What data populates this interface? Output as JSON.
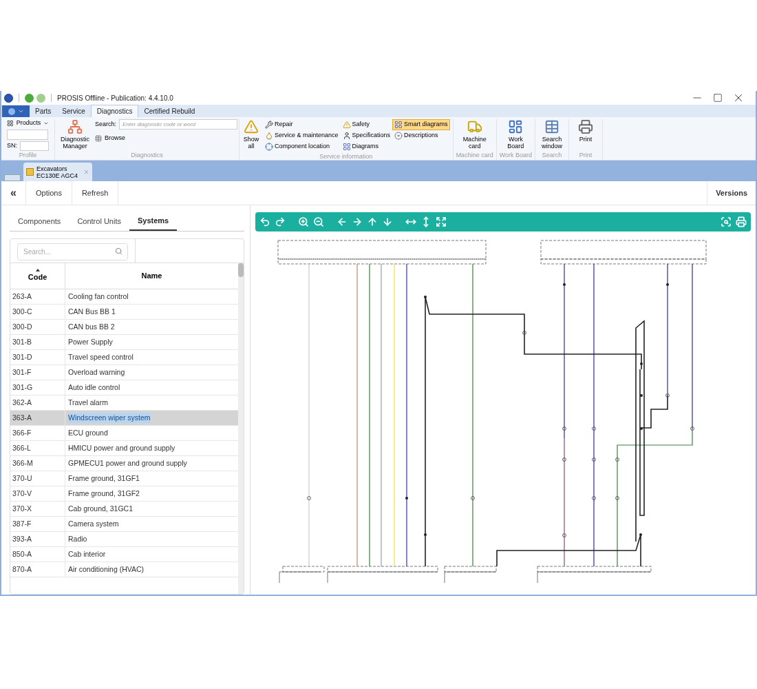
{
  "window": {
    "title": "PROSIS Offline - Publication: 4.4.10.0"
  },
  "ribbon": {
    "tabs": [
      {
        "label": "Parts",
        "selected": false
      },
      {
        "label": "Service",
        "selected": false
      },
      {
        "label": "Diagnostics",
        "selected": true
      },
      {
        "label": "Certified Rebuild",
        "selected": false
      }
    ],
    "profile": {
      "products": "Products",
      "sn_label": "SN:",
      "group": "Profile"
    },
    "diagnostics": {
      "manager": "Diagnostic Manager",
      "search_label": "Search:",
      "search_placeholder": "Enter diagnostic code or word",
      "browse": "Browse",
      "group": "Diagnostics"
    },
    "service_information": {
      "show_all": "Show all",
      "items": [
        {
          "label": "Repair",
          "kind": "wrench",
          "selected": false
        },
        {
          "label": "Service & maintenance",
          "kind": "oil",
          "selected": false
        },
        {
          "label": "Component location",
          "kind": "location",
          "selected": false
        },
        {
          "label": "Safety",
          "kind": "warning",
          "selected": false
        },
        {
          "label": "Specifications",
          "kind": "spec",
          "selected": false
        },
        {
          "label": "Diagrams",
          "kind": "grid",
          "selected": false
        },
        {
          "label": "Smart diagrams",
          "kind": "grid",
          "selected": true
        },
        {
          "label": "Descriptions",
          "kind": "disk",
          "selected": false
        }
      ],
      "group": "Service information"
    },
    "big_groups": [
      {
        "button": "Machine card",
        "kind": "machine",
        "group": "Machine card"
      },
      {
        "button": "Work Board",
        "kind": "board",
        "group": "Work Board"
      },
      {
        "button": "Search window",
        "kind": "search",
        "group": "Search"
      },
      {
        "button": "Print",
        "kind": "print",
        "group": "Print"
      }
    ]
  },
  "document_tab": {
    "line1": "Excavators",
    "line2": "EC130E AGC4"
  },
  "toolbar": {
    "collapse": "«",
    "buttons": [
      "Options",
      "Refresh"
    ],
    "versions": "Versions"
  },
  "panel_tabs": [
    {
      "label": "Components",
      "selected": false
    },
    {
      "label": "Control Units",
      "selected": false
    },
    {
      "label": "Systems",
      "selected": true
    }
  ],
  "search": {
    "placeholder": "Search..."
  },
  "table": {
    "columns": [
      "Code",
      "Name"
    ],
    "rows": [
      {
        "code": "263-A",
        "name": "Cooling fan control",
        "selected": false
      },
      {
        "code": "300-C",
        "name": "CAN Bus BB 1",
        "selected": false
      },
      {
        "code": "300-D",
        "name": "CAN bus BB 2",
        "selected": false
      },
      {
        "code": "301-B",
        "name": "Power Supply",
        "selected": false
      },
      {
        "code": "301-D",
        "name": "Travel speed control",
        "selected": false
      },
      {
        "code": "301-F",
        "name": "Overload warning",
        "selected": false
      },
      {
        "code": "301-G",
        "name": "Auto idle control",
        "selected": false
      },
      {
        "code": "362-A",
        "name": "Travel alarm",
        "selected": false
      },
      {
        "code": "363-A",
        "name": "Windscreen wiper system",
        "selected": true
      },
      {
        "code": "366-F",
        "name": "ECU ground",
        "selected": false
      },
      {
        "code": "366-L",
        "name": "HMICU power and ground supply",
        "selected": false
      },
      {
        "code": "366-M",
        "name": "GPMECU1 power and ground supply",
        "selected": false
      },
      {
        "code": "370-U",
        "name": "Frame ground, 31GF1",
        "selected": false
      },
      {
        "code": "370-V",
        "name": "Frame ground, 31GF2",
        "selected": false
      },
      {
        "code": "370-X",
        "name": "Cab ground, 31GC1",
        "selected": false
      },
      {
        "code": "387-F",
        "name": "Camera system",
        "selected": false
      },
      {
        "code": "393-A",
        "name": "Radio",
        "selected": false
      },
      {
        "code": "850-A",
        "name": "Cab interior",
        "selected": false
      },
      {
        "code": "870-A",
        "name": "Air conditioning (HVAC)",
        "selected": false
      }
    ]
  }
}
